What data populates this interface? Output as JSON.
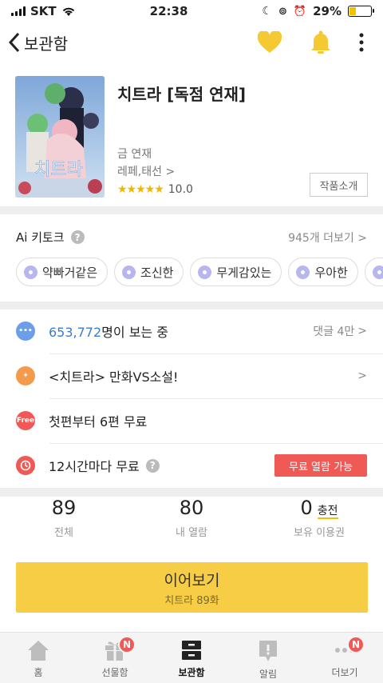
{
  "status_bar": {
    "carrier": "SKT",
    "time": "22:38",
    "battery": "29%",
    "battery_level": 0.29
  },
  "nav": {
    "back_label": "보관함"
  },
  "work": {
    "title": "치트라 [독점 연재]",
    "schedule": "금 연재",
    "authors": "레페,태선",
    "rating": "10.0",
    "intro_button": "작품소개"
  },
  "ai_keyword": {
    "title": "Ai 키토크",
    "more": "945개 더보기",
    "chips": [
      "약빠거같은",
      "조신한",
      "무게감있는",
      "우아한"
    ]
  },
  "info": {
    "viewers_count": "653,772",
    "viewers_suffix": "명이 보는 중",
    "comments": "댓글 4만",
    "event": "<치트라> 만화VS소설!",
    "free_badge": "Free",
    "free_text": "첫편부터 6편 무료",
    "timer_text": "12시간마다 무료",
    "timer_button": "무료 열람 가능"
  },
  "stats": {
    "total_num": "89",
    "total_label": "전체",
    "read_num": "80",
    "read_label": "내 열람",
    "ticket_num": "0",
    "ticket_charge": "충전",
    "ticket_label": "보유 이용권"
  },
  "continue": {
    "label": "이어보기",
    "episode": "치트라 89화"
  },
  "tabbar": {
    "home": "홈",
    "gift": "선물함",
    "library": "보관함",
    "notice": "알림",
    "more": "더보기",
    "badge": "N"
  },
  "colors": {
    "accent_yellow": "#f7cd45",
    "heart_yellow": "#f5c932",
    "red": "#ef5a57",
    "blue": "#3b7bd6"
  }
}
